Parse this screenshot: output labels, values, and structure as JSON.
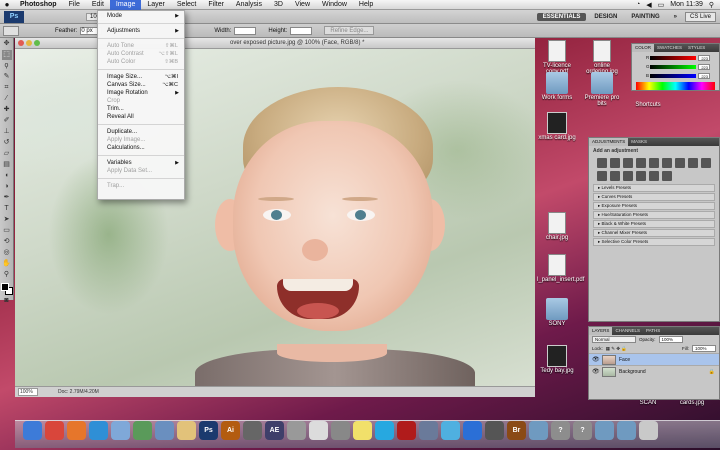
{
  "menubar": {
    "apple": "",
    "items": [
      "Photoshop",
      "File",
      "Edit",
      "Image",
      "Layer",
      "Select",
      "Filter",
      "Analysis",
      "3D",
      "View",
      "Window",
      "Help"
    ],
    "clock": "Mon 11:39",
    "status_icons": [
      "wifi-icon",
      "volume-icon",
      "battery-icon",
      "search-icon"
    ]
  },
  "appbar": {
    "zoom": "100%",
    "workspaces": [
      "ESSENTIALS",
      "DESIGN",
      "PAINTING"
    ],
    "more": "»",
    "cs_live": "CS Live"
  },
  "optbar": {
    "feather_label": "Feather:",
    "feather_value": "0 px",
    "width_label": "Width:",
    "height_label": "Height:",
    "refine": "Refine Edge..."
  },
  "document": {
    "title": "over exposed picture.jpg @ 100% (Face, RGB/8) *",
    "status_zoom": "100%",
    "status_info": "Doc: 2.79M/4.20M"
  },
  "image_menu": [
    {
      "label": "Mode",
      "submenu": true
    },
    {
      "sep": true
    },
    {
      "label": "Adjustments",
      "submenu": true
    },
    {
      "sep": true
    },
    {
      "label": "Auto Tone",
      "shortcut": "⇧⌘L",
      "disabled": true
    },
    {
      "label": "Auto Contrast",
      "shortcut": "⌥⇧⌘L",
      "disabled": true
    },
    {
      "label": "Auto Color",
      "shortcut": "⇧⌘B",
      "disabled": true
    },
    {
      "sep": true
    },
    {
      "label": "Image Size...",
      "shortcut": "⌥⌘I"
    },
    {
      "label": "Canvas Size...",
      "shortcut": "⌥⌘C"
    },
    {
      "label": "Image Rotation",
      "submenu": true
    },
    {
      "label": "Crop",
      "disabled": true
    },
    {
      "label": "Trim..."
    },
    {
      "label": "Reveal All"
    },
    {
      "sep": true
    },
    {
      "label": "Duplicate..."
    },
    {
      "label": "Apply Image...",
      "disabled": true
    },
    {
      "label": "Calculations..."
    },
    {
      "sep": true
    },
    {
      "label": "Variables",
      "submenu": true
    },
    {
      "label": "Apply Data Set...",
      "disabled": true
    },
    {
      "sep": true
    },
    {
      "label": "Trap...",
      "disabled": true
    }
  ],
  "desktop_icons": [
    {
      "label": "TV-licence copy.pdf",
      "kind": "doc"
    },
    {
      "label": "online ordering.jpg",
      "kind": "doc"
    },
    {
      "label": "Work forms",
      "kind": "folder"
    },
    {
      "label": "Premiere pro bits",
      "kind": "folder"
    },
    {
      "label": "Shortcuts",
      "kind": "dark"
    },
    {
      "label": "xmas card.jpg",
      "kind": "dark"
    },
    {
      "label": "chair.jpg",
      "kind": "doc"
    },
    {
      "label": "l_panel_insert.pdf",
      "kind": "doc"
    },
    {
      "label": "SONY",
      "kind": "folder"
    },
    {
      "label": "Tedy bay.jpg",
      "kind": "dark"
    },
    {
      "label": "SCAN",
      "kind": "folder"
    },
    {
      "label": "cards.jpg",
      "kind": "dark"
    }
  ],
  "color_panel": {
    "tabs": [
      "COLOR",
      "SWATCHES",
      "STYLES"
    ],
    "rows": [
      {
        "label": "R",
        "value": "223"
      },
      {
        "label": "G",
        "value": "223"
      },
      {
        "label": "B",
        "value": "223"
      }
    ]
  },
  "adjustments_panel": {
    "tabs": [
      "ADJUSTMENTS",
      "MASKS"
    ],
    "add_label": "Add an adjustment",
    "presets": [
      "Levels Presets",
      "Curves Presets",
      "Exposure Presets",
      "Hue/Saturation Presets",
      "Black & White Presets",
      "Channel Mixer Presets",
      "Selective Color Presets"
    ]
  },
  "layers_panel": {
    "tabs": [
      "LAYERS",
      "CHANNELS",
      "PATHS"
    ],
    "blend_mode": "Normal",
    "opacity_label": "Opacity:",
    "opacity": "100%",
    "lock_label": "Lock:",
    "fill_label": "Fill:",
    "fill": "100%",
    "layers": [
      {
        "name": "Face",
        "selected": true
      },
      {
        "name": "Background",
        "selected": false
      }
    ]
  },
  "dock_apps": [
    {
      "icon": "finder-icon",
      "text": "",
      "color": "#3d7bd8"
    },
    {
      "icon": "chrome-icon",
      "text": "",
      "color": "#d9463b"
    },
    {
      "icon": "firefox-icon",
      "text": "",
      "color": "#e6762b"
    },
    {
      "icon": "safari-icon",
      "text": "",
      "color": "#2f8fd6"
    },
    {
      "icon": "mail-icon",
      "text": "",
      "color": "#7fa8d8"
    },
    {
      "icon": "itunes-icon",
      "text": "",
      "color": "#5a9a5a"
    },
    {
      "icon": "preview-icon",
      "text": "",
      "color": "#6a8fbf"
    },
    {
      "icon": "notes-icon",
      "text": "",
      "color": "#e2c27a"
    },
    {
      "icon": "photoshop-icon",
      "text": "Ps",
      "color": "#1b3a6e"
    },
    {
      "icon": "illustrator-icon",
      "text": "Ai",
      "color": "#b35c10"
    },
    {
      "icon": "vectorworks-icon",
      "text": "",
      "color": "#666666"
    },
    {
      "icon": "after-effects-icon",
      "text": "AE",
      "color": "#3f3f6a"
    },
    {
      "icon": "system-prefs-icon",
      "text": "",
      "color": "#999999"
    },
    {
      "icon": "textedit-icon",
      "text": "",
      "color": "#dcdcdc"
    },
    {
      "icon": "calculator-icon",
      "text": "",
      "color": "#888888"
    },
    {
      "icon": "stickies-icon",
      "text": "",
      "color": "#f1e06a"
    },
    {
      "icon": "skype-icon",
      "text": "",
      "color": "#27a8e0"
    },
    {
      "icon": "acrobat-icon",
      "text": "",
      "color": "#b01b1b"
    },
    {
      "icon": "iphoto-icon",
      "text": "",
      "color": "#6a7a9a"
    },
    {
      "icon": "music-icon",
      "text": "",
      "color": "#4fb0e0"
    },
    {
      "icon": "app-store-icon",
      "text": "",
      "color": "#2b6fd6"
    },
    {
      "icon": "camera-icon",
      "text": "",
      "color": "#555555"
    },
    {
      "icon": "bridge-icon",
      "text": "Br",
      "color": "#8a4a16"
    },
    {
      "icon": "stack-folder-icon",
      "text": "",
      "color": "#6f9ac0"
    },
    {
      "icon": "help-icon",
      "text": "?",
      "color": "#8d8d8d"
    },
    {
      "icon": "help-icon-2",
      "text": "?",
      "color": "#8d8d8d"
    },
    {
      "icon": "downloads-icon",
      "text": "",
      "color": "#6f9ac0"
    },
    {
      "icon": "documents-icon",
      "text": "",
      "color": "#6f9ac0"
    },
    {
      "icon": "trash-icon",
      "text": "",
      "color": "#c9c9c9"
    }
  ],
  "colors": {
    "menu_highlight": "#3d6bd8",
    "layer_selected": "#a9c4ec"
  }
}
